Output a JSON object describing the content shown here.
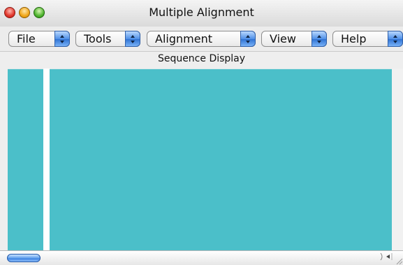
{
  "window": {
    "title": "Multiple Alignment"
  },
  "toolbar": {
    "menus": [
      {
        "label": "File"
      },
      {
        "label": "Tools"
      },
      {
        "label": "Alignment"
      },
      {
        "label": "View"
      },
      {
        "label": "Help"
      }
    ]
  },
  "main": {
    "section_label": "Sequence Display"
  },
  "colors": {
    "panel": "#4bbfc9",
    "accent": "#3a7fe0"
  },
  "icons": {
    "close": "close-button-red-circle",
    "minimize": "minimize-button-yellow-circle",
    "zoom": "zoom-button-green-circle",
    "popup_arrows": "up-down-arrows-icon",
    "scroll_left": "scroll-left-arrow-icon",
    "scroll_right": "scroll-right-arrow-icon"
  }
}
